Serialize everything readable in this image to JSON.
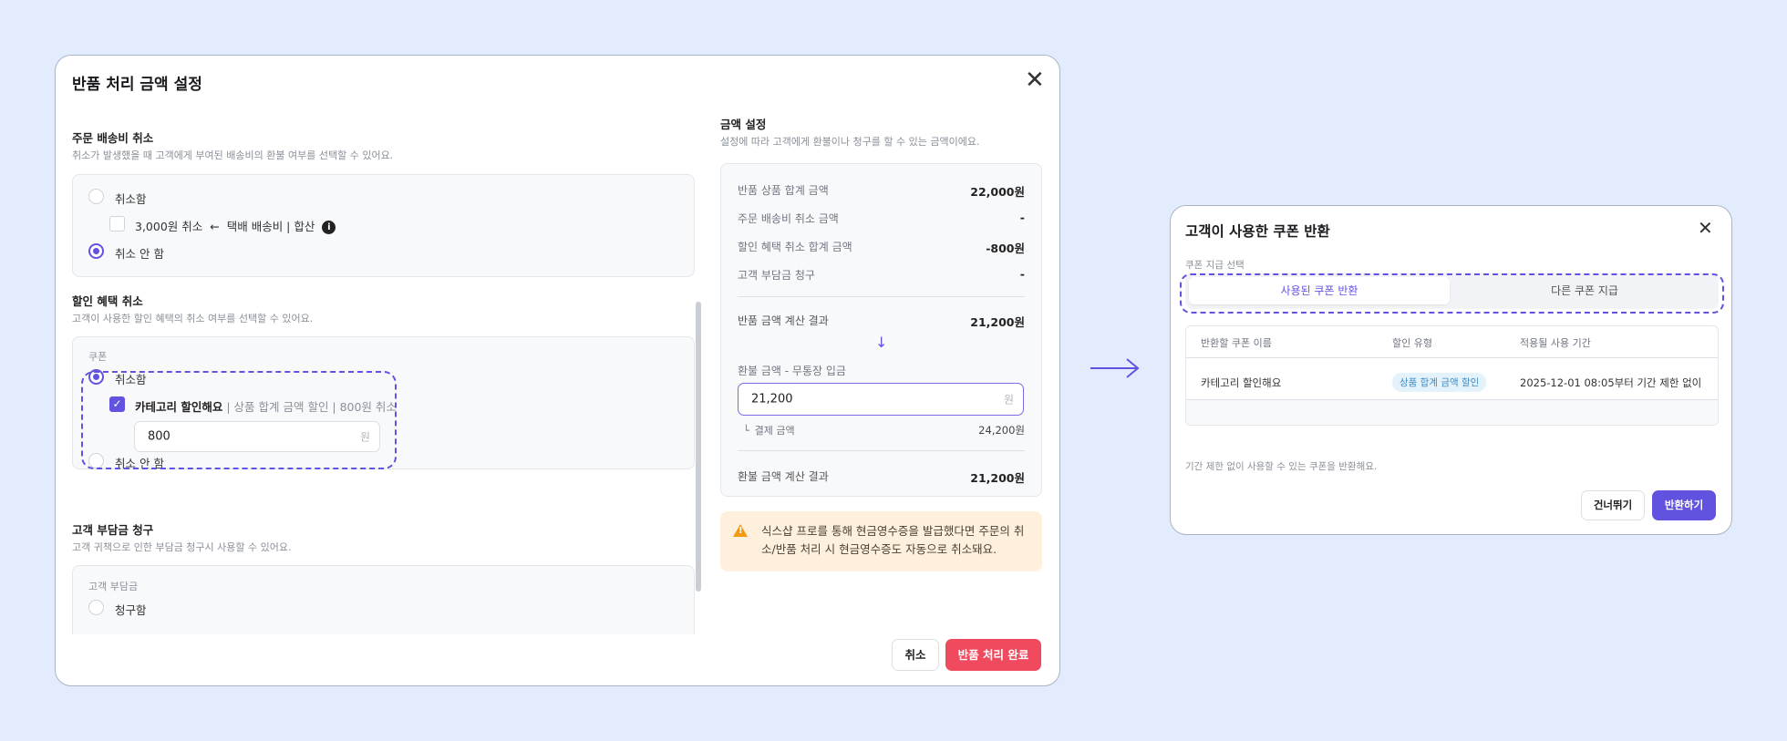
{
  "colors": {
    "accent": "#6252e0",
    "danger": "#ef4a5d",
    "warning_bg": "#fff0de",
    "background": "#e2ecfc"
  },
  "return_modal": {
    "title": "반품 처리 금액 설정",
    "shipping_cancel": {
      "title": "주문 배송비 취소",
      "desc": "취소가 발생했을 때 고객에게 부여된 배송비의 환불 여부를 선택할 수 있어요.",
      "opt_cancel": "취소함",
      "fee_label": "3,000원 취소",
      "fee_arrow": "←",
      "fee_source": "택배 배송비 | 합산",
      "opt_no_cancel": "취소 안 함"
    },
    "discount_cancel": {
      "title": "할인 혜택 취소",
      "desc": "고객이 사용한 할인 혜택의 취소 여부를 선택할 수 있어요.",
      "coupon_label": "쿠폰",
      "opt_cancel": "취소함",
      "coupon_name": "카테고리 할인해요",
      "coupon_detail": " | 상품 합계 금액 할인 | 800원 취소",
      "amount_value": "800",
      "amount_unit": "원",
      "opt_no_cancel": "취소 안 함"
    },
    "customer_charge": {
      "title": "고객 부담금 청구",
      "desc": "고객 귀책으로 인한 부담금 청구시 사용할 수 있어요.",
      "box_label": "고객 부담금",
      "opt_charge": "청구함"
    },
    "amount_settings": {
      "title": "금액 설정",
      "desc": "설정에 따라 고객에게 환불이나 청구를 할 수 있는 금액이에요.",
      "rows": [
        {
          "label": "반품 상품 합계 금액",
          "value": "22,000원"
        },
        {
          "label": "주문 배송비 취소 금액",
          "value": "-"
        },
        {
          "label": "할인 혜택 취소 합계 금액",
          "value": "-800원"
        },
        {
          "label": "고객 부담금 청구",
          "value": "-"
        }
      ],
      "calc_label": "반품 금액 계산 결과",
      "calc_value": "21,200원",
      "down_arrow": "↓",
      "refund_label": "환불 금액 - 무통장 입금",
      "refund_value": "21,200",
      "refund_unit": "원",
      "paid_prefix": "└",
      "paid_label": "결제 금액",
      "paid_value": "24,200원",
      "result_label": "환불 금액 계산 결과",
      "result_value": "21,200원"
    },
    "notice": "식스샵 프로를 통해 현금영수증을 발급했다면 주문의 취소/반품 처리 시 현금영수증도 자동으로 취소돼요.",
    "cancel_button": "취소",
    "confirm_button": "반품 처리 완료"
  },
  "coupon_modal": {
    "title": "고객이 사용한 쿠폰 반환",
    "select_label": "쿠폰 지급 선택",
    "tabs": [
      {
        "label": "사용된 쿠폰 반환",
        "active": true
      },
      {
        "label": "다른 쿠폰 지급",
        "active": false
      }
    ],
    "table": {
      "headers": [
        "반환할 쿠폰 이름",
        "할인 유형",
        "적용될 사용 기간"
      ],
      "rows": [
        {
          "name": "카테고리 할인해요",
          "type": "상품 합계 금액 할인",
          "period": "2025-12-01 08:05부터 기간 제한 없이"
        }
      ]
    },
    "footnote": "기간 제한 없이 사용할 수 있는 쿠폰을 반환해요.",
    "skip_button": "건너뛰기",
    "return_button": "반환하기"
  }
}
